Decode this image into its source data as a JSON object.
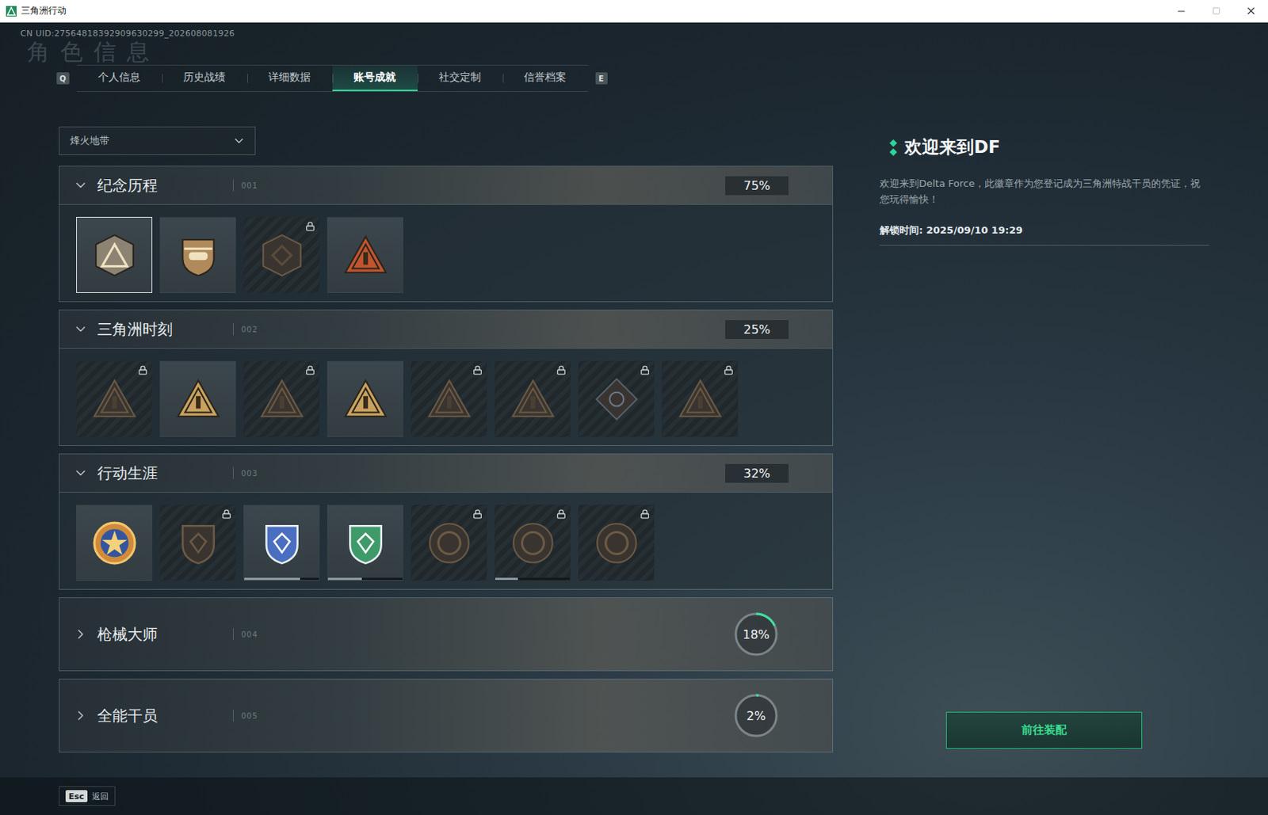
{
  "window": {
    "title": "三角洲行动",
    "uid": "CN UID:27564818392909630299_202608081926"
  },
  "heading": "角色信息",
  "tabs": {
    "prev_key": "Q",
    "next_key": "E",
    "items": [
      {
        "label": "个人信息",
        "selected": false
      },
      {
        "label": "历史战绩",
        "selected": false
      },
      {
        "label": "详细数据",
        "selected": false
      },
      {
        "label": "账号成就",
        "selected": true
      },
      {
        "label": "社交定制",
        "selected": false
      },
      {
        "label": "信誉档案",
        "selected": false
      }
    ]
  },
  "mode_select": {
    "value": "烽火地带"
  },
  "sections": [
    {
      "title": "纪念历程",
      "index": "001",
      "percent": "75%",
      "expanded": true,
      "badges": [
        {
          "locked": false,
          "selected": true
        },
        {
          "locked": false,
          "selected": false
        },
        {
          "locked": true,
          "selected": false
        },
        {
          "locked": false,
          "selected": false
        }
      ]
    },
    {
      "title": "三角洲时刻",
      "index": "002",
      "percent": "25%",
      "expanded": true,
      "badges": [
        {
          "locked": true,
          "selected": false
        },
        {
          "locked": false,
          "selected": false
        },
        {
          "locked": true,
          "selected": false
        },
        {
          "locked": false,
          "selected": false
        },
        {
          "locked": true,
          "selected": false
        },
        {
          "locked": true,
          "selected": false
        },
        {
          "locked": true,
          "selected": false
        },
        {
          "locked": true,
          "selected": false
        }
      ]
    },
    {
      "title": "行动生涯",
      "index": "003",
      "percent": "32%",
      "expanded": true,
      "badges": [
        {
          "locked": false,
          "selected": false
        },
        {
          "locked": true,
          "selected": false
        },
        {
          "locked": false,
          "selected": false,
          "level": 0.75
        },
        {
          "locked": false,
          "selected": false,
          "level": 0.45
        },
        {
          "locked": true,
          "selected": false
        },
        {
          "locked": true,
          "selected": false,
          "level": 0.3
        },
        {
          "locked": true,
          "selected": false
        }
      ]
    },
    {
      "title": "枪械大师",
      "index": "004",
      "percent": "18%",
      "level": 0.18,
      "expanded": false,
      "badges": []
    },
    {
      "title": "全能干员",
      "index": "005",
      "percent": "2%",
      "level": 0.02,
      "expanded": false,
      "badges": []
    }
  ],
  "detail": {
    "title": "欢迎来到DF",
    "description": "欢迎来到Delta Force，此徽章作为您登记成为三角洲特战干员的凭证，祝您玩得愉快！",
    "unlock_time": "解锁时间: 2025/09/10 19:29",
    "button": "前往装配"
  },
  "footer": {
    "key": "Esc",
    "label": "返回"
  }
}
